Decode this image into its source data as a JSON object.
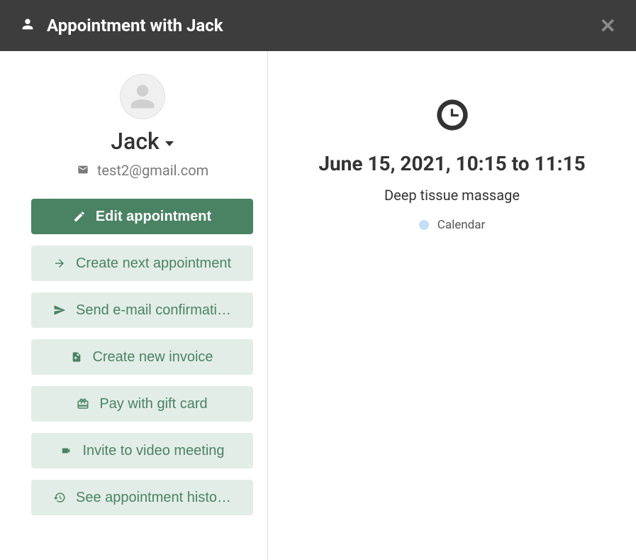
{
  "header": {
    "title": "Appointment with Jack"
  },
  "client": {
    "name": "Jack",
    "email": "test2@gmail.com"
  },
  "actions": {
    "edit": "Edit appointment",
    "create_next": "Create next appointment",
    "send_email": "Send e-mail confirmati…",
    "create_invoice": "Create new invoice",
    "pay_gift": "Pay with gift card",
    "invite_video": "Invite to video meeting",
    "history": "See appointment histo…"
  },
  "appointment": {
    "datetime": "June 15, 2021, 10:15 to 11:15",
    "service": "Deep tissue massage",
    "calendar_label": "Calendar"
  }
}
